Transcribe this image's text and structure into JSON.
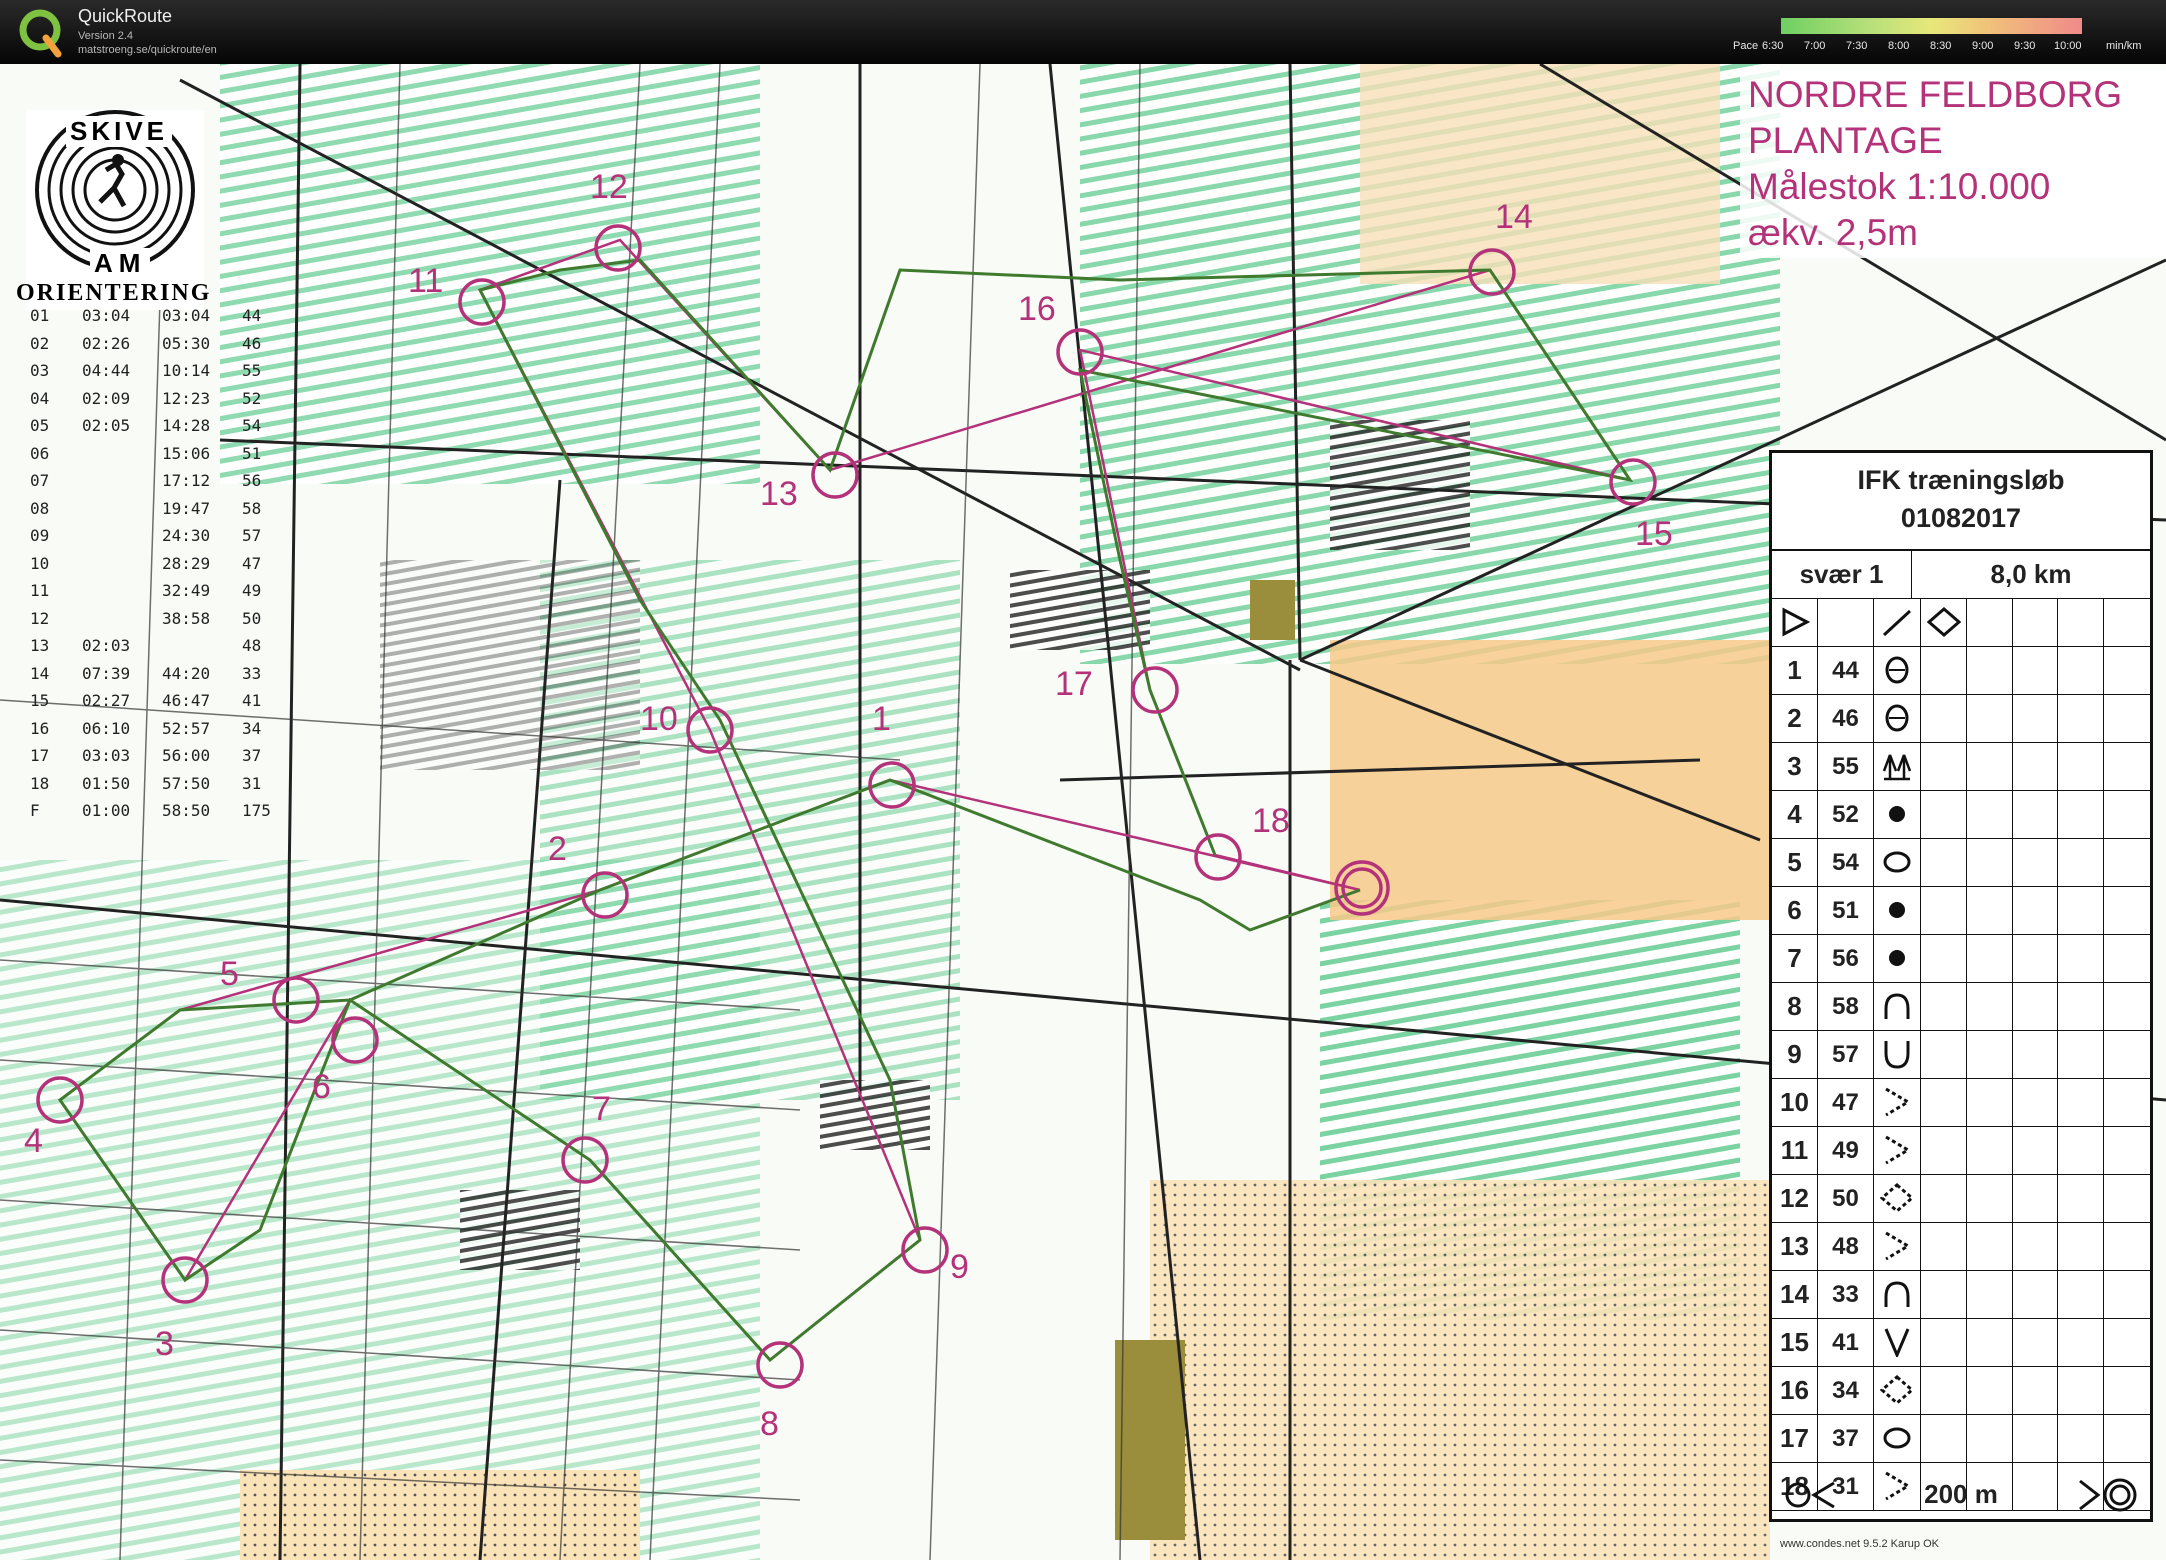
{
  "app": {
    "name": "QuickRoute",
    "version": "Version 2.4",
    "url": "matstroeng.se/quickroute/en",
    "logo_letter": "Q"
  },
  "pace_scale": {
    "label": "Pace",
    "ticks": [
      "6:30",
      "7:00",
      "7:30",
      "8:00",
      "8:30",
      "9:00",
      "9:30",
      "10:00"
    ],
    "unit": "min/km"
  },
  "map": {
    "title_lines": [
      "NORDRE FELDBORG",
      "PLANTAGE",
      "Målestok 1:10.000",
      "ækv. 2,5m"
    ],
    "club_logo_top": "SKIVE",
    "club_logo_bottom": "AM",
    "club_name": "ORIENTERING",
    "credit": "www.condes.net 9.5.2 Karup OK",
    "colors": {
      "course": "#b4327a",
      "route": "#3f7a2e",
      "forest": "#5cbf86",
      "open": "#f5c67a"
    }
  },
  "splits": [
    [
      "01",
      "03:04",
      "03:04",
      "44"
    ],
    [
      "02",
      "02:26",
      "05:30",
      "46"
    ],
    [
      "03",
      "04:44",
      "10:14",
      "55"
    ],
    [
      "04",
      "02:09",
      "12:23",
      "52"
    ],
    [
      "05",
      "02:05",
      "14:28",
      "54"
    ],
    [
      "06",
      "",
      "15:06",
      "51"
    ],
    [
      "07",
      "",
      "17:12",
      "56"
    ],
    [
      "08",
      "",
      "19:47",
      "58"
    ],
    [
      "09",
      "",
      "24:30",
      "57"
    ],
    [
      "10",
      "",
      "28:29",
      "47"
    ],
    [
      "11",
      "",
      "32:49",
      "49"
    ],
    [
      "12",
      "",
      "38:58",
      "50"
    ],
    [
      "13",
      "02:03",
      "",
      "48"
    ],
    [
      "14",
      "07:39",
      "44:20",
      "33"
    ],
    [
      "15",
      "02:27",
      "46:47",
      "41"
    ],
    [
      "16",
      "06:10",
      "52:57",
      "34"
    ],
    [
      "17",
      "03:03",
      "56:00",
      "37"
    ],
    [
      "18",
      "01:50",
      "57:50",
      "31"
    ],
    [
      "F",
      "01:00",
      "58:50",
      "175"
    ]
  ],
  "control_description": {
    "event": "IFK træningsløb",
    "date": "01082017",
    "course": "svær 1",
    "length": "8,0 km",
    "finish_distance": "200 m",
    "rows": [
      {
        "num": "1",
        "code": "44",
        "symbol": "knoll-icon"
      },
      {
        "num": "2",
        "code": "46",
        "symbol": "knoll-icon"
      },
      {
        "num": "3",
        "code": "55",
        "symbol": "tree-icon"
      },
      {
        "num": "4",
        "code": "52",
        "symbol": "dot-icon"
      },
      {
        "num": "5",
        "code": "54",
        "symbol": "oval-icon"
      },
      {
        "num": "6",
        "code": "51",
        "symbol": "dot-icon"
      },
      {
        "num": "7",
        "code": "56",
        "symbol": "dot-icon"
      },
      {
        "num": "8",
        "code": "58",
        "symbol": "hill-icon"
      },
      {
        "num": "9",
        "code": "57",
        "symbol": "depression-icon"
      },
      {
        "num": "10",
        "code": "47",
        "symbol": "reentrant-icon"
      },
      {
        "num": "11",
        "code": "49",
        "symbol": "reentrant-icon"
      },
      {
        "num": "12",
        "code": "50",
        "symbol": "diamond-icon"
      },
      {
        "num": "13",
        "code": "48",
        "symbol": "reentrant-icon"
      },
      {
        "num": "14",
        "code": "33",
        "symbol": "hill-icon"
      },
      {
        "num": "15",
        "code": "41",
        "symbol": "gully-icon"
      },
      {
        "num": "16",
        "code": "34",
        "symbol": "diamond-icon"
      },
      {
        "num": "17",
        "code": "37",
        "symbol": "oval-icon"
      },
      {
        "num": "18",
        "code": "31",
        "symbol": "reentrant-icon"
      }
    ]
  },
  "controls": [
    {
      "label": "1"
    },
    {
      "label": "2"
    },
    {
      "label": "3"
    },
    {
      "label": "4"
    },
    {
      "label": "5"
    },
    {
      "label": "6"
    },
    {
      "label": "7"
    },
    {
      "label": "8"
    },
    {
      "label": "9"
    },
    {
      "label": "10"
    },
    {
      "label": "11"
    },
    {
      "label": "12"
    },
    {
      "label": "13"
    },
    {
      "label": "14"
    },
    {
      "label": "15"
    },
    {
      "label": "16"
    },
    {
      "label": "17"
    },
    {
      "label": "18"
    }
  ]
}
